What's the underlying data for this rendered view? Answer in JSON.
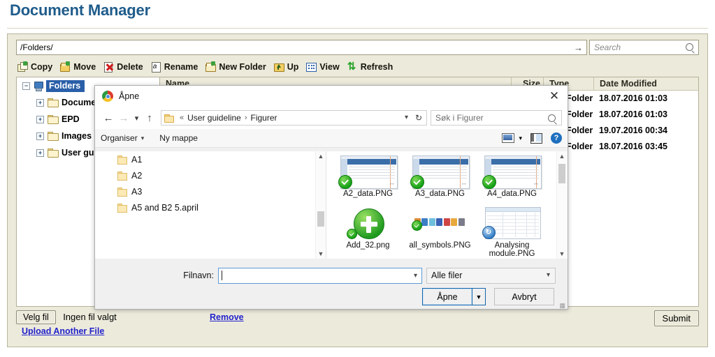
{
  "page": {
    "title": "Document Manager"
  },
  "document_manager": {
    "path_value": "/Folders/",
    "go_icon": "arrow-right-icon",
    "search_placeholder": "Search",
    "search_icon": "search-icon",
    "toolbar": [
      {
        "label": "Copy",
        "icon": "copy-icon"
      },
      {
        "label": "Move",
        "icon": "move-folder-icon"
      },
      {
        "label": "Delete",
        "icon": "delete-x-icon"
      },
      {
        "label": "Rename",
        "icon": "rename-a-icon"
      },
      {
        "label": "New Folder",
        "icon": "new-folder-icon"
      },
      {
        "label": "Up",
        "icon": "up-folder-icon"
      },
      {
        "label": "View",
        "icon": "view-grid-icon"
      },
      {
        "label": "Refresh",
        "icon": "refresh-icon"
      }
    ],
    "tree": {
      "root": {
        "label": "Folders",
        "expander": "−",
        "icon": "computer-icon",
        "selected": true
      },
      "children": [
        {
          "label": "Docume",
          "expander": "+",
          "icon": "folder-icon"
        },
        {
          "label": "EPD",
          "expander": "+",
          "icon": "folder-icon"
        },
        {
          "label": "Images",
          "expander": "+",
          "icon": "folder-icon"
        },
        {
          "label": "User gui",
          "expander": "+",
          "icon": "folder-icon"
        }
      ]
    },
    "list_headers": {
      "name": "Name",
      "size": "Size",
      "type": "Type",
      "date": "Date Modified"
    },
    "list_rows": [
      {
        "name": "",
        "size": "",
        "type": "File Folder",
        "date": "18.07.2016 01:03"
      },
      {
        "name": "",
        "size": "",
        "type": "File Folder",
        "date": "18.07.2016 01:03"
      },
      {
        "name": "",
        "size": "",
        "type": "File Folder",
        "date": "19.07.2016 00:34"
      },
      {
        "name": "",
        "size": "",
        "type": "File Folder",
        "date": "18.07.2016 03:45"
      }
    ],
    "footer": {
      "choose_file_button": "Velg fil",
      "no_file_text": "Ingen fil valgt",
      "remove_link": "Remove",
      "upload_another_link": "Upload Another File",
      "submit_button": "Submit"
    }
  },
  "open_dialog": {
    "title": "Åpne",
    "title_icon": "chrome-icon",
    "close_icon": "close-icon",
    "nav": {
      "back_icon": "arrow-left-icon",
      "forward_icon": "arrow-right-icon",
      "recent_icon": "chevron-down-icon",
      "up_icon": "arrow-up-icon",
      "address_folder_icon": "folder-icon",
      "breadcrumb_prefix": "«",
      "breadcrumb": [
        "User guideline",
        "Figurer"
      ],
      "breadcrumb_separator": "›",
      "address_dropdown_icon": "chevron-down-icon",
      "refresh_icon": "refresh-icon",
      "search_placeholder": "Søk i Figurer",
      "search_icon": "search-icon"
    },
    "commandbar": {
      "organise": "Organiser",
      "organise_caret": "▾",
      "new_folder": "Ny mappe",
      "view_icon": "view-mode-icon",
      "view_caret": "▾",
      "preview_pane_icon": "preview-pane-icon",
      "help_icon": "help-icon",
      "help_glyph": "?"
    },
    "nav_pane": {
      "items": [
        {
          "label": "A1",
          "icon": "folder-icon"
        },
        {
          "label": "A2",
          "icon": "folder-icon"
        },
        {
          "label": "A3",
          "icon": "folder-icon"
        },
        {
          "label": "A5 and B2 5.april",
          "icon": "folder-icon"
        }
      ],
      "scroll_up_icon": "chevron-up-icon",
      "scroll_down_icon": "chevron-down-icon"
    },
    "files": [
      {
        "name": "A2_data.PNG",
        "thumb": "screenshot-thumb",
        "badge": "green-check-icon"
      },
      {
        "name": "A3_data.PNG",
        "thumb": "screenshot-thumb",
        "badge": "green-check-icon"
      },
      {
        "name": "A4_data.PNG",
        "thumb": "screenshot-thumb",
        "badge": "green-check-icon"
      },
      {
        "name": "Add_32.png",
        "thumb": "green-plus-icon",
        "badge": "green-check-icon"
      },
      {
        "name": "all_symbols.PNG",
        "thumb": "symbol-strip-thumb",
        "badge": "green-check-icon"
      },
      {
        "name": "Analysing module.PNG",
        "thumb": "screenshot-thumb",
        "badge": "blue-refresh-icon"
      }
    ],
    "files_scroll": {
      "up_icon": "chevron-up-icon",
      "down_icon": "chevron-down-icon"
    },
    "bottom": {
      "filename_label": "Filnavn:",
      "filename_value": "",
      "filename_dropdown_icon": "chevron-down-icon",
      "filter_value": "Alle filer",
      "filter_dropdown_icon": "chevron-down-icon",
      "open_button": "Åpne",
      "open_split_icon": "▼",
      "cancel_button": "Avbryt",
      "resize_grip_icon": "resize-grip-icon"
    }
  },
  "colors": {
    "heading": "#1F5C8B",
    "panel_bg": "#ECEADB",
    "link": "#2222CC",
    "selection": "#2A5FA8",
    "dialog_bg": "#F0F0F0",
    "accent_green": "#17A117"
  }
}
